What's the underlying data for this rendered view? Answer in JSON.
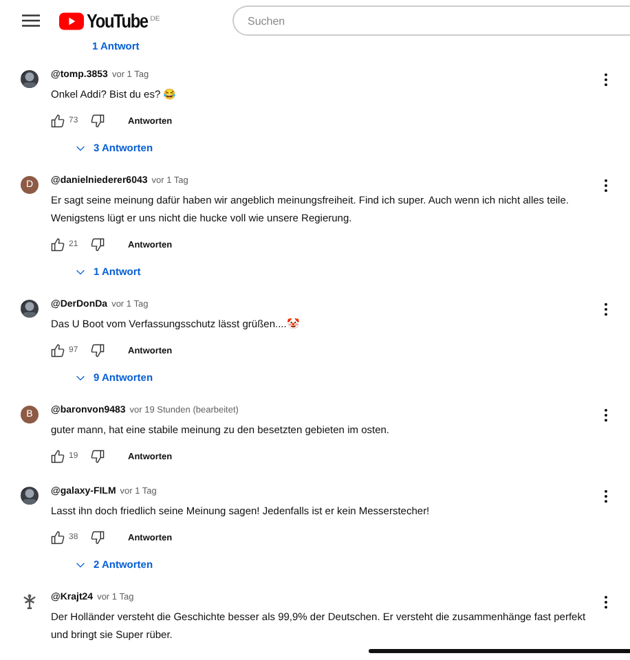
{
  "header": {
    "logo": "YouTube",
    "region": "DE",
    "search": {
      "placeholder": "Suchen"
    }
  },
  "top_replies": "1 Antwort",
  "comments": [
    {
      "author": "@tomp.3853",
      "time": "vor 1 Tag",
      "text": "Onkel Addi? Bist du es? 😂",
      "likes": "73",
      "reply": "Antworten",
      "replies": "3 Antworten"
    },
    {
      "author": "@danielniederer6043",
      "time": "vor 1 Tag",
      "avatar": {
        "kind": "letter",
        "letter": "D"
      },
      "text": "Er sagt seine meinung dafür haben wir angeblich meinungsfreiheit. Find ich super. Auch wenn ich nicht alles teile. Wenigstens lügt er uns nicht die hucke voll wie unsere Regierung.",
      "likes": "21",
      "reply": "Antworten",
      "replies": "1 Antwort"
    },
    {
      "author": "@DerDonDa",
      "time": "vor 1 Tag",
      "text": "Das U Boot vom Verfassungsschutz lässt grüßen....🤡",
      "likes": "97",
      "reply": "Antworten",
      "replies": "9 Antworten"
    },
    {
      "author": "@baronvon9483",
      "time": "vor 19 Stunden (bearbeitet)",
      "avatar": {
        "kind": "letter",
        "letter": "B"
      },
      "text": "guter mann, hat eine stabile meinung zu den besetzten gebieten im osten.",
      "likes": "19",
      "reply": "Antworten"
    },
    {
      "author": "@galaxy-FILM",
      "time": "vor 1 Tag",
      "text": "Lasst ihn doch friedlich seine Meinung sagen! Jedenfalls ist er kein Messerstecher!",
      "likes": "38",
      "reply": "Antworten",
      "replies": "2 Antworten"
    },
    {
      "author": "@Krajt24",
      "time": "vor 1 Tag",
      "avatar": {
        "kind": "figure"
      },
      "text": "Der Holländer versteht die Geschichte besser als 99,9% der Deutschen. Er versteht die zusammenhänge fast perfekt und bringt sie Super rüber."
    }
  ]
}
